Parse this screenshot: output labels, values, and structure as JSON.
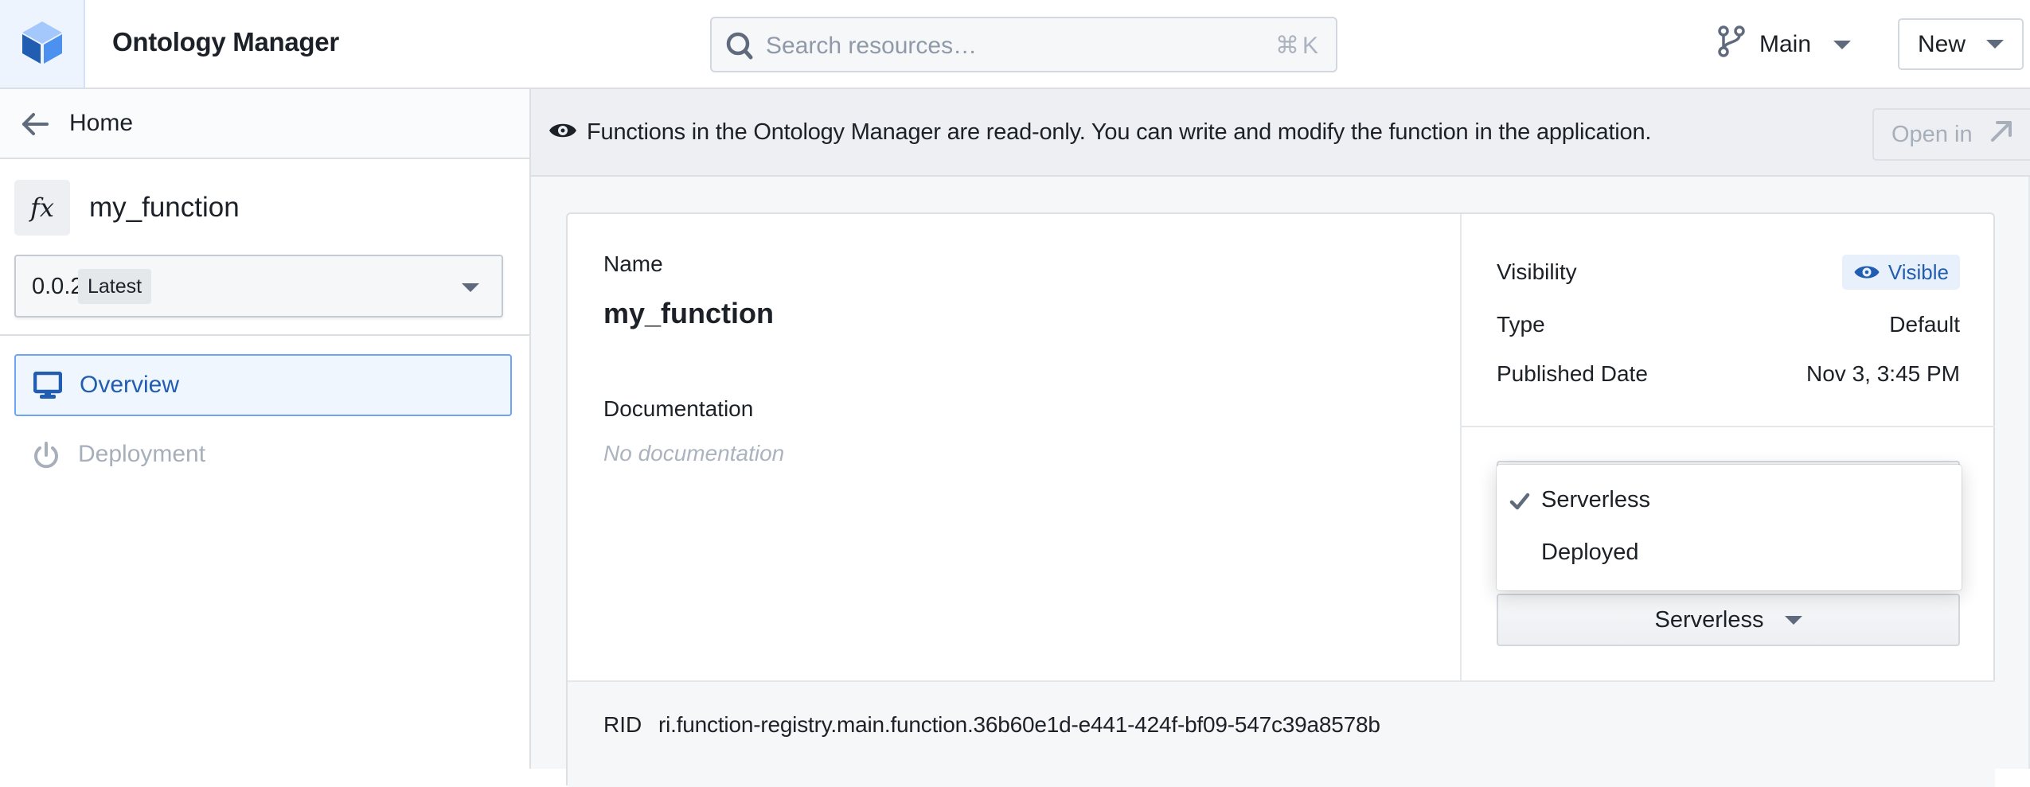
{
  "header": {
    "logo_icon": "cube-logo-icon",
    "app_title": "Ontology Manager",
    "search": {
      "icon": "search-icon",
      "placeholder": "Search resources…",
      "value": "",
      "shortcut_symbol": "⌘",
      "shortcut_key": "K"
    },
    "branch": {
      "icon": "git-branch-icon",
      "label": "Main"
    },
    "new_button": {
      "label": "New"
    }
  },
  "sidebar": {
    "back": {
      "icon": "arrow-left-icon",
      "label": "Home"
    },
    "resource": {
      "icon_text": "fx",
      "name": "my_function"
    },
    "version_select": {
      "version": "0.0.2",
      "tag": "Latest"
    },
    "nav_items": [
      {
        "label": "Overview",
        "icon": "desktop-icon",
        "state": "active"
      },
      {
        "label": "Deployment",
        "icon": "power-icon",
        "state": "disabled"
      }
    ]
  },
  "banner": {
    "icon": "eye-icon",
    "message": "Functions in the Ontology Manager are read-only. You can write and modify the function in the application.",
    "open_in_label": "Open in"
  },
  "overview": {
    "name_label": "Name",
    "name_value": "my_function",
    "documentation_label": "Documentation",
    "documentation_empty": "No documentation",
    "properties": [
      {
        "label": "Visibility",
        "value": "Visible",
        "kind": "badge"
      },
      {
        "label": "Type",
        "value": "Default",
        "kind": "text"
      },
      {
        "label": "Published Date",
        "value": "Nov 3, 3:45 PM",
        "kind": "text"
      }
    ],
    "runtime_select": {
      "selected": "Serverless",
      "options": [
        {
          "label": "Serverless",
          "checked": true
        },
        {
          "label": "Deployed",
          "checked": false
        }
      ]
    },
    "rid_label": "RID",
    "rid_value": "ri.function-registry.main.function.36b60e1d-e441-424f-bf09-547c39a8578b"
  },
  "colors": {
    "accent": "#215db0",
    "accent_light": "#e8f0fc",
    "border": "#dce0e5",
    "muted_text": "#a7afba"
  }
}
